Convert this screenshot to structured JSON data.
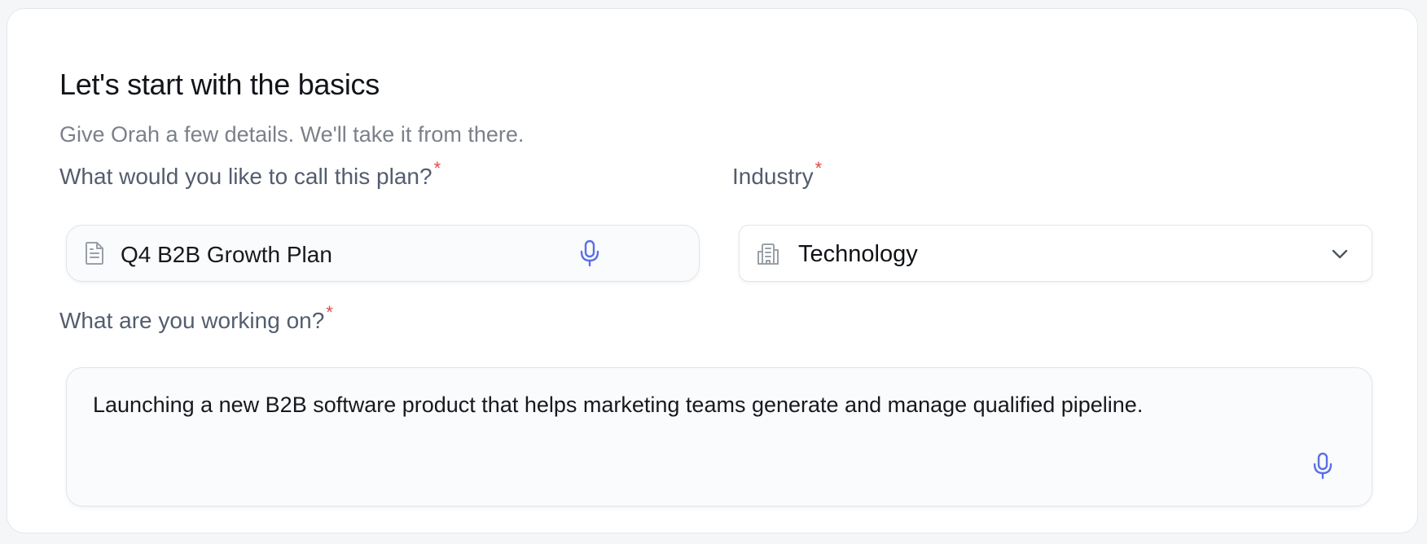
{
  "form": {
    "title": "Let's start with the basics",
    "subtitle": "Give Orah a few details. We'll take it from there.",
    "required_mark": "*",
    "plan_name": {
      "label": "What would you like to call this plan?",
      "value": "Q4 B2B Growth Plan",
      "icon": "document-icon",
      "action_icon": "microphone-icon"
    },
    "industry": {
      "label": "Industry",
      "value": "Technology",
      "icon": "building-icon",
      "action_icon": "chevron-down-icon"
    },
    "working_on": {
      "label": "What are you working on?",
      "value": "Launching a new B2B software product that helps marketing teams generate and manage qualified pipeline.",
      "action_icon": "microphone-icon"
    }
  },
  "colors": {
    "accent": "#5b6ee8",
    "required": "#e04848",
    "label": "#535d6e",
    "muted": "#7b808a",
    "border": "#e1e4e8"
  }
}
